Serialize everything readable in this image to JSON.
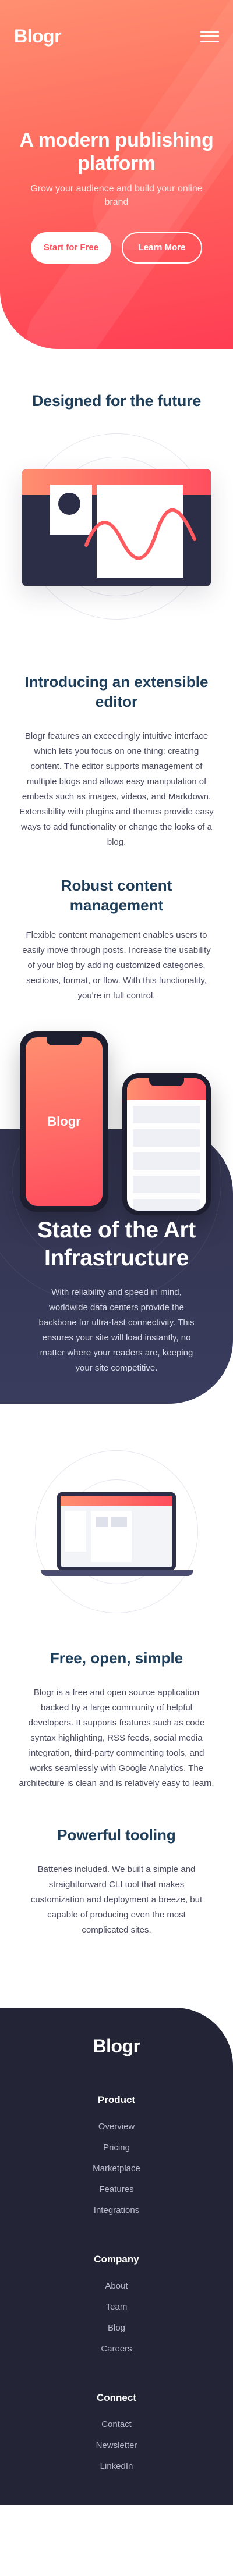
{
  "header": {
    "logo": "Blogr",
    "menu_icon": "hamburger-menu-icon"
  },
  "hero": {
    "title": "A modern publishing platform",
    "subtitle": "Grow your audience and build your online brand",
    "primary_button": "Start for Free",
    "secondary_button": "Learn More"
  },
  "future": {
    "title": "Designed for the future",
    "editor_title": "Introducing an extensible editor",
    "editor_text": "Blogr features an exceedingly intuitive interface which lets you focus on one thing: creating content. The editor supports management of multiple blogs and allows easy manipulation of embeds such as images, videos, and Markdown. Extensibility with plugins and themes provide easy ways to add functionality or change the looks of a blog.",
    "robust_title": "Robust content management",
    "robust_text": "Flexible content management enables users to easily move through posts. Increase the usability of your blog by adding customized categories, sections, format, or flow. With this functionality, you're in full control."
  },
  "phones": {
    "phone_logo": "Blogr"
  },
  "infrastructure": {
    "title": "State of the Art Infrastructure",
    "text": "With reliability and speed in mind, worldwide data centers provide the backbone for ultra-fast connectivity. This ensures your site will load instantly, no matter where your readers are, keeping your site competitive."
  },
  "features": {
    "free_title": "Free, open, simple",
    "free_text": "Blogr is a free and open source application backed by a large community of helpful developers. It supports features such as code syntax highlighting, RSS feeds, social media integration, third-party commenting tools, and works seamlessly with Google Analytics. The architecture is clean and is relatively easy to learn.",
    "tooling_title": "Powerful tooling",
    "tooling_text": "Batteries included. We built a simple and straightforward CLI tool that makes customization and deployment a breeze, but capable of producing even the most complicated sites."
  },
  "footer": {
    "logo": "Blogr",
    "groups": [
      {
        "heading": "Product",
        "links": [
          "Overview",
          "Pricing",
          "Marketplace",
          "Features",
          "Integrations"
        ]
      },
      {
        "heading": "Company",
        "links": [
          "About",
          "Team",
          "Blog",
          "Careers"
        ]
      },
      {
        "heading": "Connect",
        "links": [
          "Contact",
          "Newsletter",
          "LinkedIn"
        ]
      }
    ]
  },
  "colors": {
    "accent_from": "#ff8f70",
    "accent_to": "#ff3d54",
    "heading": "#1f3e5a",
    "dark": "#232536"
  }
}
